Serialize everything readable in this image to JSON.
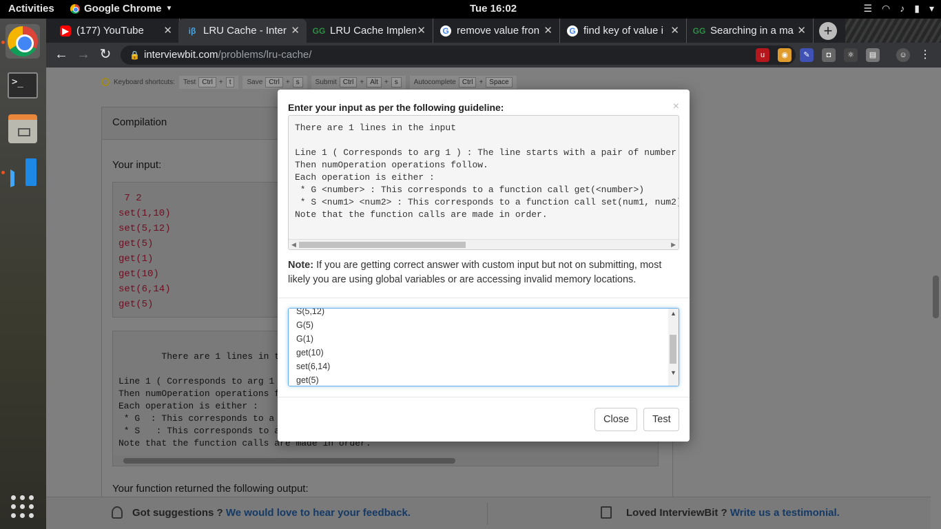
{
  "topbar": {
    "activities": "Activities",
    "app_name": "Google Chrome",
    "app_menu_icon": "chevron-down-icon",
    "clock": "Tue 16:02"
  },
  "tabs": [
    {
      "title": "(177) YouTube",
      "favicon": "youtube-icon"
    },
    {
      "title": "LRU Cache - Inter",
      "favicon": "interviewbit-icon"
    },
    {
      "title": "LRU Cache Implem",
      "favicon": "geeksforgeeks-icon"
    },
    {
      "title": "remove value fron",
      "favicon": "google-icon"
    },
    {
      "title": "find key of value i",
      "favicon": "google-icon"
    },
    {
      "title": "Searching in a ma",
      "favicon": "geeksforgeeks-icon"
    }
  ],
  "address": {
    "domain": "interviewbit.com",
    "path": "/problems/lru-cache/"
  },
  "shortcuts": {
    "label": "Keyboard shortcuts:",
    "test": "Test",
    "ctrl": "Ctrl",
    "plus": "+",
    "t": "t",
    "save": "Save",
    "s": "s",
    "submit": "Submit",
    "alt": "Alt",
    "autocomplete": "Autocomplete",
    "space": "Space"
  },
  "compilation": {
    "header": "Compilation",
    "your_input": "Your input:",
    "input_text": " 7 2\nset(1,10)\nset(5,12)\nget(5)\nget(1)\nget(10)\nset(6,14)\nget(5)",
    "guide_text": "There are 1 lines in the input\n\nLine 1 ( Corresponds to arg 1 ) : The line starts with a pair of number\nThen numOperation operations follow.\nEach operation is either :\n * G  : This corresponds to a function call get(<number>)\n * S   : This corresponds to a function call set(num1, num2)\nNote that the function calls are made in order.",
    "output_label": "Your function returned the following output:"
  },
  "footer": {
    "suggest_prefix": "Got suggestions ?",
    "suggest_link": "We would love to hear your feedback.",
    "loved_prefix": "Loved InterviewBit ?",
    "loved_link": "Write us a testimonial."
  },
  "modal": {
    "title": "Enter your input as per the following guideline:",
    "close_x": "×",
    "guide_text": "There are 1 lines in the input\n\nLine 1 ( Corresponds to arg 1 ) : The line starts with a pair of number\nThen numOperation operations follow.\nEach operation is either :\n * G <number> : This corresponds to a function call get(<number>)\n * S <num1> <num2> : This corresponds to a function call set(num1, num2)\nNote that the function calls are made in order.",
    "note_label": "Note:",
    "note_text": " If you are getting correct answer with custom input but not on submitting, most likely you are using global variables or are accessing invalid memory locations.",
    "input_lines": [
      "S(5,12)",
      "G(5)",
      "G(1)",
      "get(10)",
      "set(6,14)",
      "get(5)"
    ],
    "close_button": "Close",
    "test_button": "Test"
  }
}
